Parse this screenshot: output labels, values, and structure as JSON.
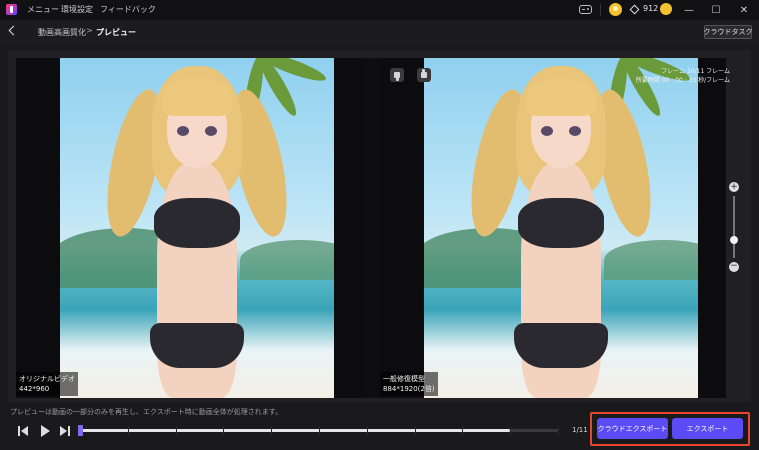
{
  "titlebar": {
    "menu": [
      "メニュー",
      "環境設定",
      "フィードバック"
    ],
    "credits": "912",
    "window_controls": {
      "minimize": "—",
      "maximize": "☐",
      "close": "✕"
    }
  },
  "header": {
    "breadcrumb": [
      "動画高画質化",
      "プレビュー"
    ],
    "breadcrumb_separator": ">",
    "cloud_task_label": "クラウドタスク"
  },
  "preview": {
    "left": {
      "title": "オリジナルビデオ",
      "resolution": "442*960"
    },
    "right": {
      "title": "一般修復模型",
      "resolution": "884*1920(2倍)"
    },
    "frame_info": [
      "フレーム 10/11 フレーム",
      "所要時間 00 : 00 : 33 秒/フレーム"
    ],
    "zoom": {
      "plus": "+",
      "minus": "−",
      "level": 0.35
    }
  },
  "playback": {
    "notice": "プレビューは動画の一部分のみを再生し、エクスポート時に動画全体が処理されます。",
    "frame_counter": "1/11",
    "progress": 0.9
  },
  "actions": {
    "cloud_export": "クラウドエクスポート",
    "export": "エクスポート"
  },
  "colors": {
    "accent": "#5b4bf5",
    "highlight": "#e8452c",
    "credit": "#f2c230"
  }
}
